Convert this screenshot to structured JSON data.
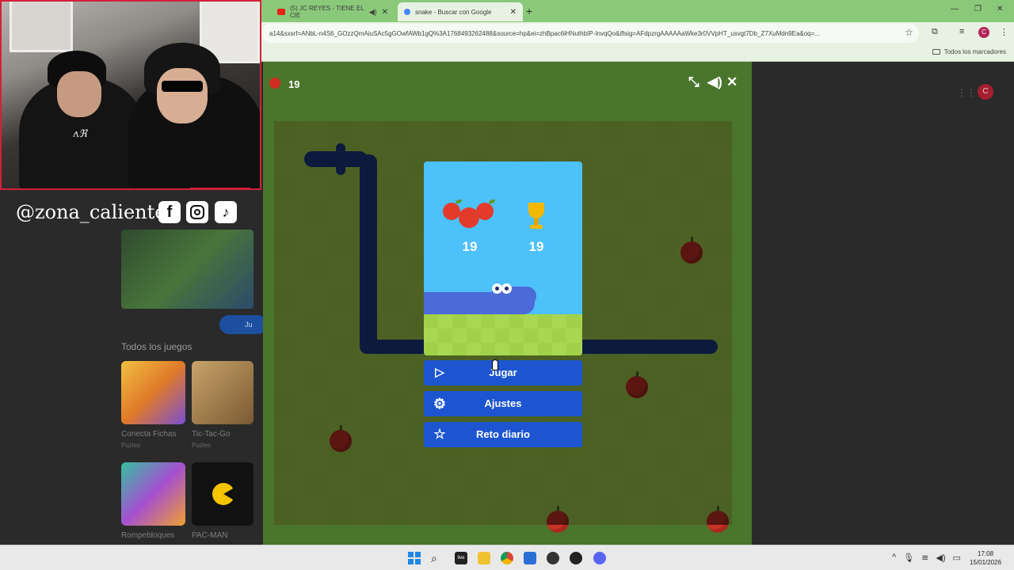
{
  "browser": {
    "tabs": [
      {
        "label": "(5) JC REYES - TIENE EL CIE",
        "active": false
      },
      {
        "label": "snake - Buscar con Google",
        "active": true
      }
    ],
    "new_tab": "+",
    "address": "a14&sxsrf=ANbL-n4S6_GOzzQmAiuSAc5gGOwfAWb1gQ%3A1768493262488&source=hp&ei=zhBpac6iHNuthbIP-InvqQo&iflsig=AFdpzrgAAAAAaWke3r0VVpHT_usvgt7Db_Z7XuMdn9Ea&oq=...",
    "profile_initial": "C",
    "bookmarks_all": "Todos los marcadores"
  },
  "overlay": {
    "handle": "@zona_caliente",
    "social_icons": [
      "facebook-icon",
      "instagram-icon",
      "tiktok-icon"
    ]
  },
  "games_list": {
    "section_title": "Todos los juegos",
    "play_chip": "Ju",
    "games": [
      {
        "name": "Conecta Fichas",
        "category": "Puzles"
      },
      {
        "name": "Tic-Tac-Go",
        "category": "Puzles"
      },
      {
        "name": "Rompebloques",
        "category": ""
      },
      {
        "name": "PAC-MAN",
        "category": ""
      }
    ]
  },
  "game": {
    "header_score": "19",
    "controls": [
      "fullscreen-exit-icon",
      "volume-icon",
      "close-icon"
    ],
    "card": {
      "score": "19",
      "best_score": "19"
    },
    "menu": [
      {
        "label": "Jugar",
        "icon": "play-icon"
      },
      {
        "label": "Ajustes",
        "icon": "gear-icon"
      },
      {
        "label": "Reto diario",
        "icon": "star-icon"
      }
    ]
  },
  "taskbar": {
    "time": "17:08",
    "date": "15/01/2026",
    "apps": [
      "start-icon",
      "search-icon",
      "live-icon",
      "explorer-icon",
      "chrome-icon",
      "store-icon",
      "obs-icon",
      "media-icon",
      "discord-icon"
    ]
  },
  "colors": {
    "tab_strip": "#8ac97a",
    "game_frame": "#4a752c",
    "menu_button": "#1c55cf",
    "card_sky": "#4dc1f9",
    "snake": "#1e3a8a"
  }
}
